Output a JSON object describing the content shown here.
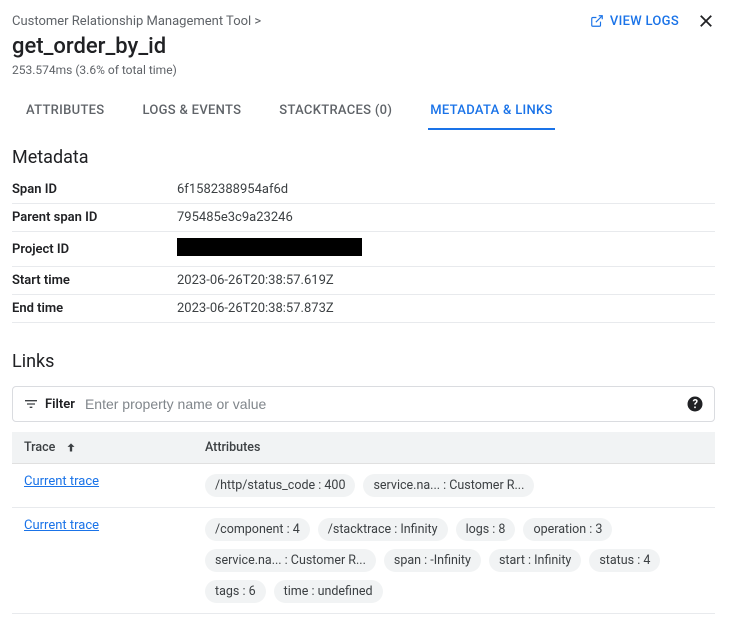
{
  "breadcrumb": "Customer Relationship Management Tool >",
  "title": "get_order_by_id",
  "subtitle": "253.574ms  (3.6% of total time)",
  "view_logs_label": "VIEW LOGS",
  "tabs": {
    "attributes": "ATTRIBUTES",
    "logs_events": "LOGS & EVENTS",
    "stacktraces": "STACKTRACES (0)",
    "metadata_links": "METADATA & LINKS"
  },
  "metadata_heading": "Metadata",
  "metadata": {
    "span_id": {
      "label": "Span ID",
      "value": "6f1582388954af6d"
    },
    "parent_span_id": {
      "label": "Parent span ID",
      "value": "795485e3c9a23246"
    },
    "project_id": {
      "label": "Project ID",
      "value": ""
    },
    "start_time": {
      "label": "Start time",
      "value": "2023-06-26T20:38:57.619Z"
    },
    "end_time": {
      "label": "End time",
      "value": "2023-06-26T20:38:57.873Z"
    }
  },
  "links_heading": "Links",
  "filter": {
    "label": "Filter",
    "placeholder": "Enter property name or value"
  },
  "links_table": {
    "col_trace": "Trace",
    "col_attributes": "Attributes",
    "rows": [
      {
        "trace_label": "Current trace",
        "attrs": [
          "/http/status_code : 400",
          "service.na... : Customer R..."
        ]
      },
      {
        "trace_label": "Current trace",
        "attrs": [
          "/component : 4",
          "/stacktrace : Infinity",
          "logs : 8",
          "operation : 3",
          "service.na... : Customer R...",
          "span : -Infinity",
          "start : Infinity",
          "status : 4",
          "tags : 6",
          "time : undefined"
        ]
      }
    ]
  }
}
